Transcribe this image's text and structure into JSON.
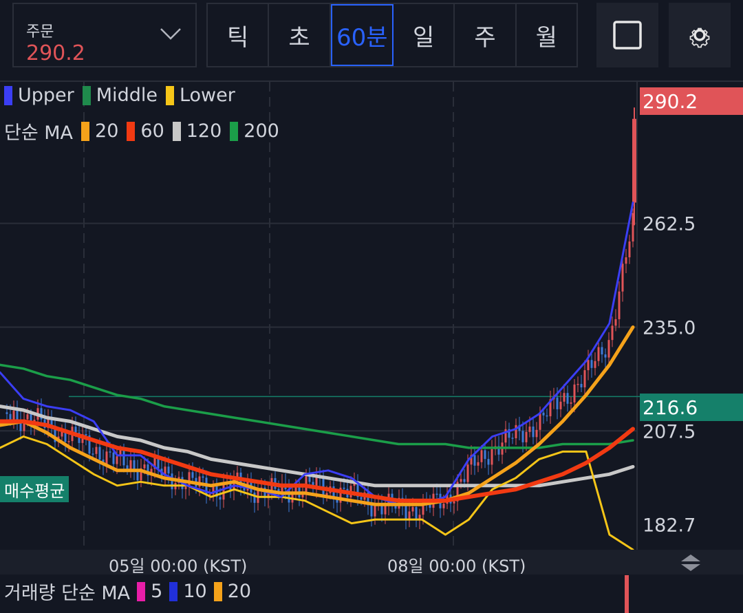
{
  "order": {
    "label": "주문",
    "value": "290.2"
  },
  "timeframes": [
    "틱",
    "초",
    "60분",
    "일",
    "주",
    "월"
  ],
  "active_timeframe": "60분",
  "icons": {
    "layout": "square-icon",
    "settings": "gear-icon",
    "dropdown": "chevron-down-icon",
    "resize": "resize-updown-icon"
  },
  "colors": {
    "up": "#e05458",
    "down": "#3d7bd9",
    "upper": "#3b3ef5",
    "middle": "#1f8a4c",
    "lower": "#f5c518",
    "ma20": "#f5a21a",
    "ma60": "#f23a12",
    "ma120": "#c8c8c8",
    "ma200": "#1b9e49",
    "avg": "#15806a"
  },
  "legend_bb": [
    {
      "label": "Upper",
      "color": "#3b3ef5"
    },
    {
      "label": "Middle",
      "color": "#1f8a4c"
    },
    {
      "label": "Lower",
      "color": "#f5c518"
    }
  ],
  "legend_ma": {
    "prefix": "단순 MA",
    "items": [
      {
        "label": "20",
        "color": "#f5a21a"
      },
      {
        "label": "60",
        "color": "#f23a12"
      },
      {
        "label": "120",
        "color": "#c8c8c8"
      },
      {
        "label": "200",
        "color": "#1b9e49"
      }
    ]
  },
  "price_tag": "290.2",
  "avg_tag": {
    "label": "매수평균",
    "value": "216.6"
  },
  "volume_legend": {
    "prefix": "거래량 단순 MA",
    "items": [
      {
        "label": "5",
        "color": "#e91ea8"
      },
      {
        "label": "10",
        "color": "#2130d9"
      },
      {
        "label": "20",
        "color": "#f5a21a"
      }
    ]
  },
  "chart_data": {
    "type": "line",
    "ylim": [
      176,
      300
    ],
    "y_ticks": [
      "262.5",
      "235.0",
      "207.5",
      "182.7"
    ],
    "x_tick_labels": [
      "05일 00:00 (KST)",
      "08일 00:00 (KST)"
    ],
    "grid": true,
    "close_price": 290.2,
    "buy_average": 216.6,
    "series": [
      {
        "name": "Upper",
        "values": [
          223,
          216,
          214,
          213,
          210,
          201,
          201,
          196,
          193,
          191,
          193,
          192,
          190,
          196,
          197,
          195,
          190,
          188,
          188,
          190,
          200,
          206,
          208,
          212,
          219,
          226,
          236,
          268
        ]
      },
      {
        "name": "Middle",
        "values": [
          213,
          211,
          209,
          206,
          203,
          199,
          198,
          196,
          194,
          192,
          193,
          192,
          191,
          193,
          192,
          191,
          188,
          187,
          187,
          189,
          197,
          203,
          206,
          210,
          216,
          222,
          232,
          262
        ]
      },
      {
        "name": "Lower",
        "values": [
          203,
          206,
          204,
          200,
          196,
          193,
          194,
          193,
          193,
          190,
          192,
          190,
          190,
          189,
          186,
          183,
          184,
          184,
          184,
          180,
          184,
          192,
          195,
          200,
          202,
          202,
          180,
          176
        ]
      },
      {
        "name": "20",
        "values": [
          209,
          210,
          207,
          203,
          200,
          197,
          197,
          195,
          194,
          193,
          194,
          192,
          191,
          191,
          190,
          189,
          188,
          188,
          188,
          189,
          191,
          195,
          199,
          204,
          210,
          217,
          225,
          235
        ]
      },
      {
        "name": "60",
        "values": [
          210,
          210,
          209,
          207,
          205,
          203,
          202,
          200,
          198,
          196,
          195,
          194,
          193,
          193,
          192,
          191,
          190,
          189,
          189,
          189,
          190,
          191,
          192,
          194,
          196,
          199,
          203,
          208
        ]
      },
      {
        "name": "120",
        "values": [
          214,
          213,
          211,
          210,
          208,
          206,
          205,
          203,
          202,
          200,
          199,
          198,
          197,
          196,
          195,
          194,
          193,
          193,
          193,
          193,
          193,
          193,
          193,
          193,
          194,
          195,
          196,
          198
        ]
      },
      {
        "name": "200",
        "values": [
          225,
          224,
          222,
          221,
          219,
          217,
          216,
          214,
          213,
          212,
          211,
          210,
          209,
          208,
          207,
          206,
          205,
          204,
          204,
          204,
          203,
          203,
          203,
          203,
          204,
          204,
          204,
          205
        ]
      }
    ]
  }
}
